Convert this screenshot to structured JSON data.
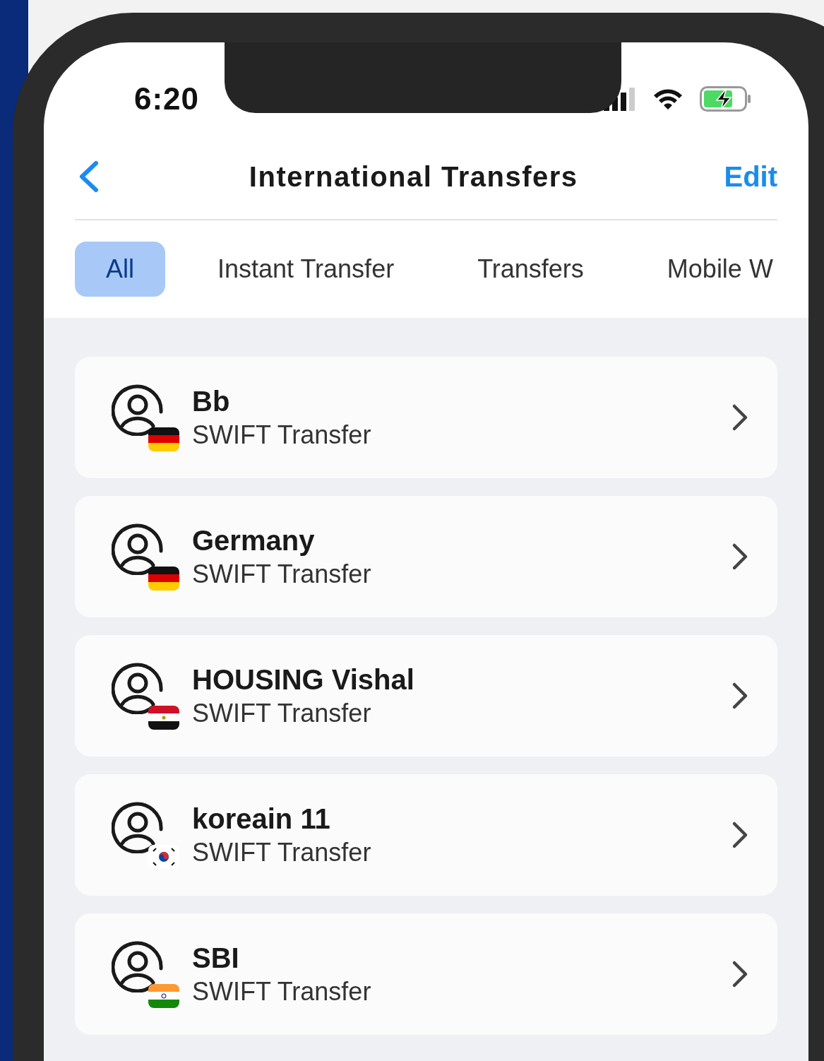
{
  "status_bar": {
    "time": "6:20"
  },
  "header": {
    "title": "International Transfers",
    "action": "Edit"
  },
  "tabs": [
    {
      "label": "All",
      "selected": true
    },
    {
      "label": "Instant Transfer",
      "selected": false
    },
    {
      "label": "Transfers",
      "selected": false
    },
    {
      "label": "Mobile W",
      "selected": false
    }
  ],
  "contacts": [
    {
      "name": "Bb",
      "subtitle": "SWIFT Transfer",
      "kind": "de"
    },
    {
      "name": "Germany",
      "subtitle": "SWIFT Transfer",
      "kind": "de"
    },
    {
      "name": "HOUSING Vishal",
      "subtitle": "SWIFT Transfer",
      "kind": "eg"
    },
    {
      "name": "koreain 11",
      "subtitle": "SWIFT Transfer",
      "kind": "kr"
    },
    {
      "name": "SBI",
      "subtitle": "SWIFT Transfer",
      "kind": "in"
    }
  ]
}
